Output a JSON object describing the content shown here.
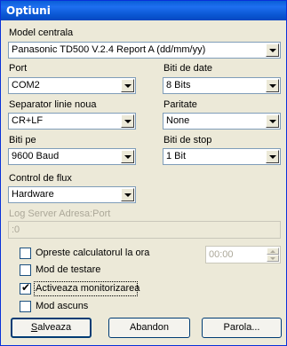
{
  "window": {
    "title": "Optiuni"
  },
  "model_centrala": {
    "label": "Model centrala",
    "value": "Panasonic TD500 V.2.4 Report A (dd/mm/yy)"
  },
  "port": {
    "label": "Port",
    "value": "COM2"
  },
  "biti_date": {
    "label": "Biti de date",
    "value": "8 Bits"
  },
  "separator": {
    "label": "Separator linie noua",
    "value": "CR+LF"
  },
  "paritate": {
    "label": "Paritate",
    "value": "None"
  },
  "biti_pe": {
    "label": "Biti pe",
    "value": "9600 Baud"
  },
  "biti_stop": {
    "label": "Biti de stop",
    "value": "1 Bit"
  },
  "control_flux": {
    "label": "Control de flux",
    "value": "Hardware"
  },
  "log_server": {
    "label": "Log Server Adresa:Port",
    "value": ":0"
  },
  "checkboxes": [
    {
      "label": "Opreste calculatorul la ora",
      "checked": false
    },
    {
      "label": "Mod de testare",
      "checked": false
    },
    {
      "label": "Activeaza monitorizarea",
      "checked": true
    },
    {
      "label": "Mod ascuns",
      "checked": false
    }
  ],
  "time_value": "00:00",
  "buttons": {
    "save": "Salveaza",
    "cancel": "Abandon",
    "password": "Parola..."
  },
  "colors": {
    "accent": "#0a5fd6",
    "face": "#ece9d8"
  }
}
